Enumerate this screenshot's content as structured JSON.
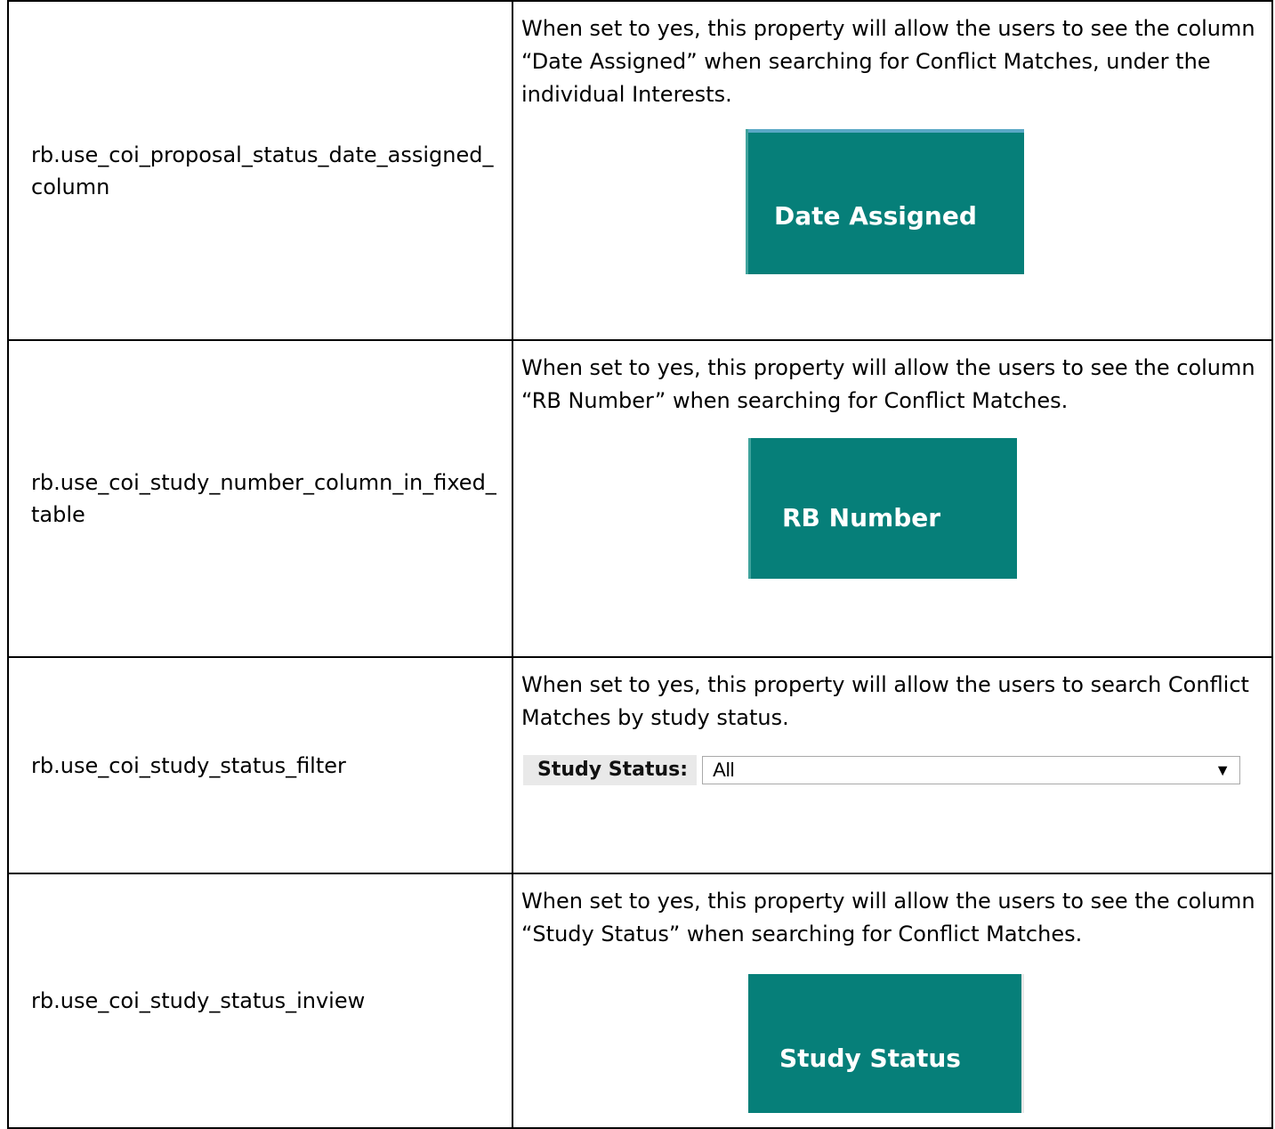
{
  "rows": [
    {
      "property": "rb.use_coi_proposal_status_date_assigned_column",
      "description": "When set to yes, this property will allow the users to see the column “Date Assigned” when searching for Conflict Matches, under the individual Interests.",
      "image_label": "Date Assigned"
    },
    {
      "property": "rb.use_coi_study_number_column_in_fixed_table",
      "description": "When set to yes, this property will allow the users to see the column “RB Number” when searching for Conflict Matches.",
      "image_label": "RB Number"
    },
    {
      "property": "rb.use_coi_study_status_filter",
      "description": "When set to yes, this property will allow the users to search Conflict Matches by study status.",
      "filter_label": "Study Status:",
      "filter_value": "All",
      "filter_arrow_icon": "triangle-down-icon"
    },
    {
      "property": "rb.use_coi_study_status_inview",
      "description": "When set to yes, this property will allow the users to see the column “Study Status” when searching for Conflict Matches.",
      "image_label": "Study Status"
    }
  ],
  "colors": {
    "header_teal": "#067f79",
    "filter_label_bg": "#e9e9e9",
    "border": "#000000"
  }
}
